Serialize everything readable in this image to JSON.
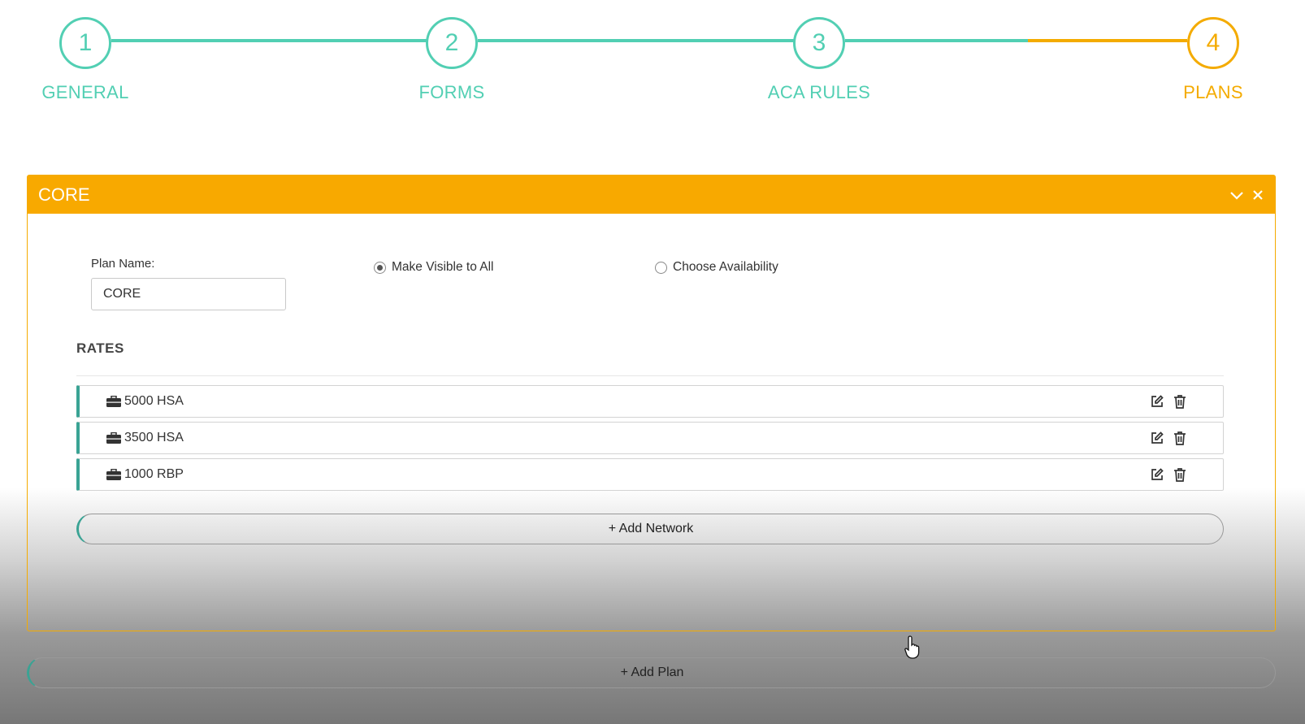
{
  "stepper": {
    "steps": [
      {
        "number": "1",
        "label": "GENERAL"
      },
      {
        "number": "2",
        "label": "FORMS"
      },
      {
        "number": "3",
        "label": "ACA RULES"
      },
      {
        "number": "4",
        "label": "PLANS"
      }
    ],
    "active_step": 4
  },
  "panel": {
    "title": "CORE",
    "plan_name_label": "Plan Name:",
    "plan_name_value": "CORE",
    "visibility_options": [
      {
        "label": "Make Visible to All",
        "selected": true
      },
      {
        "label": "Choose Availability",
        "selected": false
      }
    ],
    "rates_title": "RATES",
    "rates": [
      {
        "name": "5000 HSA"
      },
      {
        "name": "3500 HSA"
      },
      {
        "name": "1000 RBP"
      }
    ],
    "add_network_label": "+ Add Network"
  },
  "add_plan_label": "+ Add Plan",
  "colors": {
    "teal": "#52cfb3",
    "orange": "#f8a900",
    "row_accent": "#3aa394"
  }
}
